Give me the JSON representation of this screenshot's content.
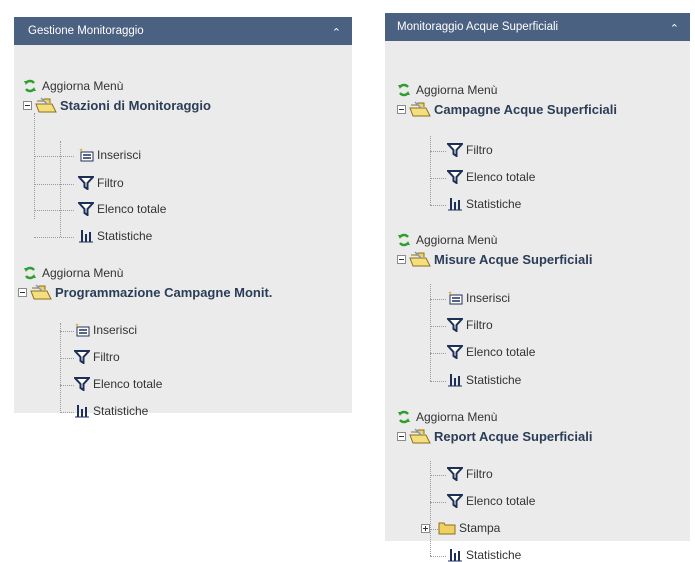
{
  "left_panel": {
    "title": "Gestione Monitoraggio",
    "groups": [
      {
        "refresh_label": "Aggiorna Menù",
        "section_title": "Stazioni di Monitoraggio",
        "items": [
          {
            "label": "Inserisci",
            "icon": "insert-icon"
          },
          {
            "label": "Filtro",
            "icon": "filter-icon"
          },
          {
            "label": "Elenco totale",
            "icon": "filter-icon"
          },
          {
            "label": "Statistiche",
            "icon": "statistics-icon"
          }
        ]
      },
      {
        "refresh_label": "Aggiorna Menù",
        "section_title": "Programmazione Campagne Monit.",
        "items": [
          {
            "label": "Inserisci",
            "icon": "insert-icon"
          },
          {
            "label": "Filtro",
            "icon": "filter-icon"
          },
          {
            "label": "Elenco totale",
            "icon": "filter-icon"
          },
          {
            "label": "Statistiche",
            "icon": "statistics-icon"
          }
        ]
      }
    ]
  },
  "right_panel": {
    "title": "Monitoraggio Acque Superficiali",
    "groups": [
      {
        "refresh_label": "Aggiorna Menù",
        "section_title": "Campagne Acque Superficiali",
        "items": [
          {
            "label": "Filtro",
            "icon": "filter-icon"
          },
          {
            "label": "Elenco totale",
            "icon": "filter-icon"
          },
          {
            "label": "Statistiche",
            "icon": "statistics-icon"
          }
        ]
      },
      {
        "refresh_label": "Aggiorna Menù",
        "section_title": "Misure Acque Superficiali",
        "items": [
          {
            "label": "Inserisci",
            "icon": "insert-icon"
          },
          {
            "label": "Filtro",
            "icon": "filter-icon"
          },
          {
            "label": "Elenco totale",
            "icon": "filter-icon"
          },
          {
            "label": "Statistiche",
            "icon": "statistics-icon"
          }
        ]
      },
      {
        "refresh_label": "Aggiorna Menù",
        "section_title": "Report Acque Superficiali",
        "items": [
          {
            "label": "Filtro",
            "icon": "filter-icon"
          },
          {
            "label": "Elenco totale",
            "icon": "filter-icon"
          },
          {
            "label": "Stampa",
            "icon": "folder-icon",
            "collapsed": true
          },
          {
            "label": "Statistiche",
            "icon": "statistics-icon"
          }
        ]
      }
    ]
  },
  "colors": {
    "header_bg": "#4a6181",
    "panel_bg": "#ebebeb",
    "section_text": "#2b3d57",
    "refresh_green": "#2e9e2e",
    "filter_navy": "#1e2f57",
    "folder_yellow": "#f0d060"
  }
}
